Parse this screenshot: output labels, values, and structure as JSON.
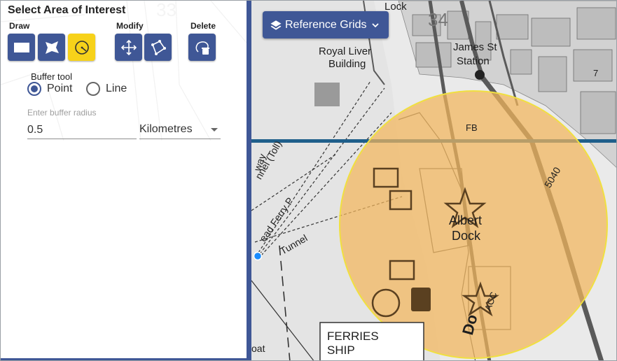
{
  "panel": {
    "title": "Select Area of Interest",
    "groups": {
      "draw": "Draw",
      "modify": "Modify",
      "delete": "Delete"
    },
    "tools": [
      {
        "name": "rectangle-icon",
        "active": false
      },
      {
        "name": "polygon-icon",
        "active": false
      },
      {
        "name": "circle-icon",
        "active": true
      },
      {
        "name": "move-icon",
        "active": false
      },
      {
        "name": "reshape-icon",
        "active": false
      },
      {
        "name": "delete-shape-icon",
        "active": false
      }
    ],
    "buffer": {
      "title": "Buffer tool",
      "options": [
        {
          "label": "Point",
          "checked": true
        },
        {
          "label": "Line",
          "checked": false
        }
      ],
      "radius_label": "Enter buffer radius",
      "radius_value": "0.5",
      "unit_value": "Kilometres"
    }
  },
  "map": {
    "reference_grids_label": "Reference Grids",
    "labels": {
      "lock": "Lock",
      "grid_33": "33",
      "grid_34": "34",
      "royal_liver": "Royal Liver",
      "building": "Building",
      "james_st": "James St",
      "station": "Station",
      "fb": "FB",
      "albert": "Albert",
      "dock": "Dock",
      "tunnel_toll": "nnel (Toll)",
      "way": "way",
      "ferry": "ead Ferry P",
      "tunnel": "Tunnel",
      "num_7": "7",
      "num_5040": "5040",
      "acc": "ACC",
      "do": "Do",
      "ferries": "FERRIES",
      "ship": "SHIP",
      "boat": "oat"
    },
    "colors": {
      "buffer_fill": "#f2b65c",
      "buffer_stroke": "#f0e040",
      "accent": "#3f5796",
      "active_tool": "#f7d21a",
      "grid_line": "#1f5f8b",
      "point": "#1a8cff"
    }
  }
}
